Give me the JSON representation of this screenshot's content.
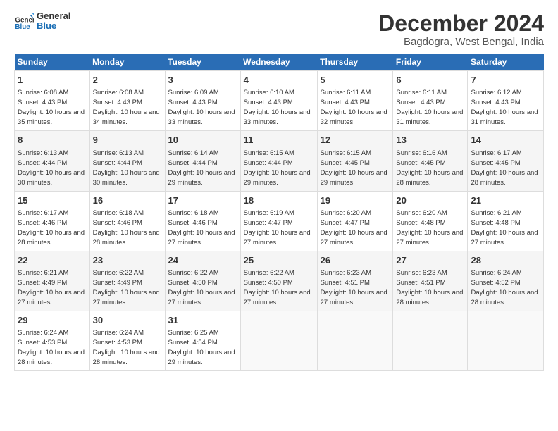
{
  "header": {
    "logo_line1": "General",
    "logo_line2": "Blue",
    "month_title": "December 2024",
    "location": "Bagdogra, West Bengal, India"
  },
  "weekdays": [
    "Sunday",
    "Monday",
    "Tuesday",
    "Wednesday",
    "Thursday",
    "Friday",
    "Saturday"
  ],
  "weeks": [
    [
      {
        "day": "1",
        "sunrise": "6:08 AM",
        "sunset": "4:43 PM",
        "daylight": "10 hours and 35 minutes."
      },
      {
        "day": "2",
        "sunrise": "6:08 AM",
        "sunset": "4:43 PM",
        "daylight": "10 hours and 34 minutes."
      },
      {
        "day": "3",
        "sunrise": "6:09 AM",
        "sunset": "4:43 PM",
        "daylight": "10 hours and 33 minutes."
      },
      {
        "day": "4",
        "sunrise": "6:10 AM",
        "sunset": "4:43 PM",
        "daylight": "10 hours and 33 minutes."
      },
      {
        "day": "5",
        "sunrise": "6:11 AM",
        "sunset": "4:43 PM",
        "daylight": "10 hours and 32 minutes."
      },
      {
        "day": "6",
        "sunrise": "6:11 AM",
        "sunset": "4:43 PM",
        "daylight": "10 hours and 31 minutes."
      },
      {
        "day": "7",
        "sunrise": "6:12 AM",
        "sunset": "4:43 PM",
        "daylight": "10 hours and 31 minutes."
      }
    ],
    [
      {
        "day": "8",
        "sunrise": "6:13 AM",
        "sunset": "4:44 PM",
        "daylight": "10 hours and 30 minutes."
      },
      {
        "day": "9",
        "sunrise": "6:13 AM",
        "sunset": "4:44 PM",
        "daylight": "10 hours and 30 minutes."
      },
      {
        "day": "10",
        "sunrise": "6:14 AM",
        "sunset": "4:44 PM",
        "daylight": "10 hours and 29 minutes."
      },
      {
        "day": "11",
        "sunrise": "6:15 AM",
        "sunset": "4:44 PM",
        "daylight": "10 hours and 29 minutes."
      },
      {
        "day": "12",
        "sunrise": "6:15 AM",
        "sunset": "4:45 PM",
        "daylight": "10 hours and 29 minutes."
      },
      {
        "day": "13",
        "sunrise": "6:16 AM",
        "sunset": "4:45 PM",
        "daylight": "10 hours and 28 minutes."
      },
      {
        "day": "14",
        "sunrise": "6:17 AM",
        "sunset": "4:45 PM",
        "daylight": "10 hours and 28 minutes."
      }
    ],
    [
      {
        "day": "15",
        "sunrise": "6:17 AM",
        "sunset": "4:46 PM",
        "daylight": "10 hours and 28 minutes."
      },
      {
        "day": "16",
        "sunrise": "6:18 AM",
        "sunset": "4:46 PM",
        "daylight": "10 hours and 28 minutes."
      },
      {
        "day": "17",
        "sunrise": "6:18 AM",
        "sunset": "4:46 PM",
        "daylight": "10 hours and 27 minutes."
      },
      {
        "day": "18",
        "sunrise": "6:19 AM",
        "sunset": "4:47 PM",
        "daylight": "10 hours and 27 minutes."
      },
      {
        "day": "19",
        "sunrise": "6:20 AM",
        "sunset": "4:47 PM",
        "daylight": "10 hours and 27 minutes."
      },
      {
        "day": "20",
        "sunrise": "6:20 AM",
        "sunset": "4:48 PM",
        "daylight": "10 hours and 27 minutes."
      },
      {
        "day": "21",
        "sunrise": "6:21 AM",
        "sunset": "4:48 PM",
        "daylight": "10 hours and 27 minutes."
      }
    ],
    [
      {
        "day": "22",
        "sunrise": "6:21 AM",
        "sunset": "4:49 PM",
        "daylight": "10 hours and 27 minutes."
      },
      {
        "day": "23",
        "sunrise": "6:22 AM",
        "sunset": "4:49 PM",
        "daylight": "10 hours and 27 minutes."
      },
      {
        "day": "24",
        "sunrise": "6:22 AM",
        "sunset": "4:50 PM",
        "daylight": "10 hours and 27 minutes."
      },
      {
        "day": "25",
        "sunrise": "6:22 AM",
        "sunset": "4:50 PM",
        "daylight": "10 hours and 27 minutes."
      },
      {
        "day": "26",
        "sunrise": "6:23 AM",
        "sunset": "4:51 PM",
        "daylight": "10 hours and 27 minutes."
      },
      {
        "day": "27",
        "sunrise": "6:23 AM",
        "sunset": "4:51 PM",
        "daylight": "10 hours and 28 minutes."
      },
      {
        "day": "28",
        "sunrise": "6:24 AM",
        "sunset": "4:52 PM",
        "daylight": "10 hours and 28 minutes."
      }
    ],
    [
      {
        "day": "29",
        "sunrise": "6:24 AM",
        "sunset": "4:53 PM",
        "daylight": "10 hours and 28 minutes."
      },
      {
        "day": "30",
        "sunrise": "6:24 AM",
        "sunset": "4:53 PM",
        "daylight": "10 hours and 28 minutes."
      },
      {
        "day": "31",
        "sunrise": "6:25 AM",
        "sunset": "4:54 PM",
        "daylight": "10 hours and 29 minutes."
      },
      null,
      null,
      null,
      null
    ]
  ]
}
